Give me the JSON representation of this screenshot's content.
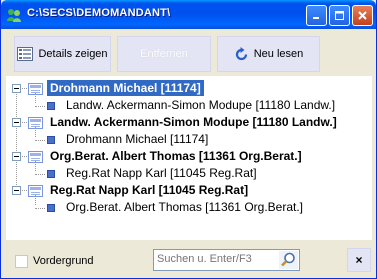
{
  "window": {
    "title": "C:\\SECS\\DEMOMANDANT\\",
    "minimize_icon": "minimize-icon",
    "maximize_icon": "maximize-icon",
    "close_icon": "close-icon"
  },
  "toolbar": {
    "details_label": "Details zeigen",
    "remove_label": "Entfernen",
    "reload_label": "Neu lesen"
  },
  "tree": {
    "nodes": [
      {
        "label": "Drohmann Michael [11174]",
        "selected": true,
        "child": "Landw. Ackermann-Simon Modupe [11180 Landw.]"
      },
      {
        "label": "Landw. Ackermann-Simon Modupe [11180 Landw.]",
        "selected": false,
        "child": "Drohmann Michael [11174]"
      },
      {
        "label": "Org.Berat. Albert Thomas [11361 Org.Berat.]",
        "selected": false,
        "child": "Reg.Rat Napp Karl [11045 Reg.Rat]"
      },
      {
        "label": "Reg.Rat Napp Karl [11045 Reg.Rat]",
        "selected": false,
        "child": "Org.Berat. Albert Thomas [11361 Org.Berat.]"
      }
    ]
  },
  "footer": {
    "foreground_label": "Vordergrund",
    "foreground_checked": false,
    "search_placeholder": "Suchen u. Enter/F3",
    "clear_label": "×"
  },
  "colors": {
    "titlebar": "#0054E3",
    "selection": "#316AC5",
    "button_face": "#E3E4F4",
    "window_bg": "#ECE9D8"
  }
}
